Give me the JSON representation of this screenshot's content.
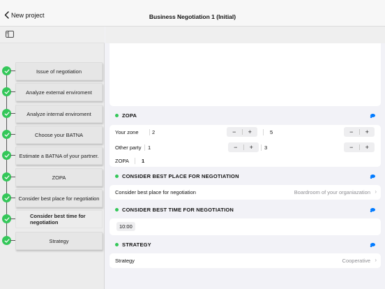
{
  "nav": {
    "back_label": "New project",
    "title": "Business Negotiation 1 (Initial)"
  },
  "sidebar": {
    "steps": [
      {
        "label": "Issue of negotiation",
        "done": true
      },
      {
        "label": "Analyze external enviroment",
        "done": true
      },
      {
        "label": "Analyze internal enviroment",
        "done": true
      },
      {
        "label": "Choose your BATNA",
        "done": true
      },
      {
        "label": "Estimate a BATNA of your partner.",
        "done": true
      },
      {
        "label": "ZOPA",
        "done": true
      },
      {
        "label": "Consider best place for negotiation",
        "done": true
      },
      {
        "label": "Consider best time for negotiation",
        "done": true,
        "active": true
      },
      {
        "label": "Strategy",
        "done": true
      }
    ]
  },
  "zopa": {
    "header": "ZOPA",
    "your_zone_label": "Your zone",
    "your_zone_min": "2",
    "your_zone_max": "5",
    "other_party_label": "Other party",
    "other_party_min": "1",
    "other_party_max": "3",
    "zopa_label": "ZOPA",
    "zopa_value": "1"
  },
  "place": {
    "header": "CONSIDER BEST PLACE FOR NEGOTIATION",
    "row_label": "Consider best place for negotiation",
    "row_value": "Boardroom of your organiazation"
  },
  "time": {
    "header": "CONSIDER BEST TIME FOR NEGOTIATION",
    "value": "10:00"
  },
  "strategy": {
    "header": "STRATEGY",
    "row_label": "Strategy",
    "row_value": "Cooperative"
  },
  "stepper": {
    "minus": "−",
    "plus": "+"
  },
  "chevron": "›",
  "colors": {
    "accent": "#007aff",
    "success": "#34c759"
  }
}
